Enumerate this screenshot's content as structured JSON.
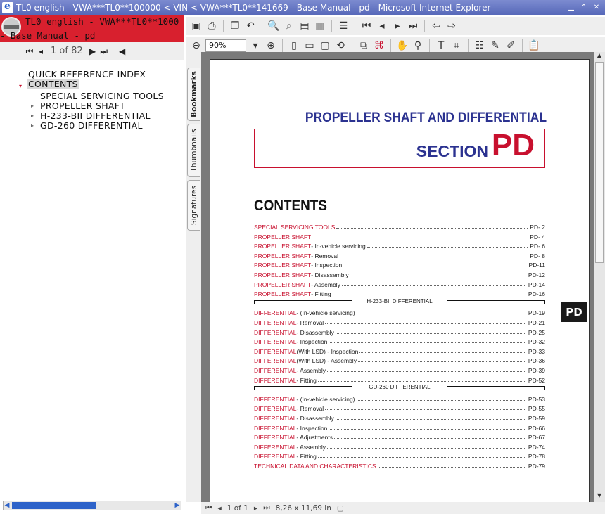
{
  "window": {
    "title": "TL0 english - VWA***TL0**100000 < VIN < VWA***TL0**141669 - Base Manual - pd - Microsoft Internet Explorer"
  },
  "left_panel": {
    "header_line1": "TL0 english - VWA***TL0**1000",
    "header_line2": "- Base Manual - pd",
    "page_indicator": "1 of 82",
    "tree": [
      {
        "label": "QUICK REFERENCE INDEX",
        "toggle": ""
      },
      {
        "label": "CONTENTS",
        "toggle": "▾"
      },
      {
        "label": "SPECIAL SERVICING TOOLS",
        "toggle": ""
      },
      {
        "label": "PROPELLER SHAFT",
        "toggle": "▸"
      },
      {
        "label": "H-233-BII DIFFERENTIAL",
        "toggle": "▸"
      },
      {
        "label": "GD-260 DIFFERENTIAL",
        "toggle": "▸"
      }
    ]
  },
  "toolbar": {
    "zoom": "90%"
  },
  "side_tabs": [
    "Bookmarks",
    "Thumbnails",
    "Signatures"
  ],
  "document": {
    "heading": "PROPELLER SHAFT AND DIFFERENTIAL",
    "section_word": "SECTION",
    "section_code": "PD",
    "contents_title": "CONTENTS",
    "section_tab": "PD",
    "toc": [
      {
        "red": "SPECIAL SERVICING TOOLS",
        "black": "",
        "page": "PD-  2"
      },
      {
        "red": "PROPELLER SHAFT",
        "black": "",
        "page": "PD-  4"
      },
      {
        "red": "PROPELLER SHAFT",
        "black": " - In-vehicle servicing",
        "page": "PD-  6"
      },
      {
        "red": "PROPELLER SHAFT",
        "black": " - Removal",
        "page": "PD-  8"
      },
      {
        "red": "PROPELLER SHAFT",
        "black": " - Inspection",
        "page": "PD-11"
      },
      {
        "red": "PROPELLER SHAFT",
        "black": " - Disassembly",
        "page": "PD-12"
      },
      {
        "red": "PROPELLER SHAFT",
        "black": " - Assembly",
        "page": "PD-14"
      },
      {
        "red": "PROPELLER SHAFT",
        "black": " - Fitting",
        "page": "PD-16"
      },
      {
        "sub": "H-233-BII DIFFERENTIAL"
      },
      {
        "red": "DIFFERENTIAL",
        "black": " - (In-vehicle servicing)",
        "page": "PD-19"
      },
      {
        "red": "DIFFERENTIAL",
        "black": " - Removal",
        "page": "PD-21"
      },
      {
        "red": "DIFFERENTIAL",
        "black": " - Disassembly",
        "page": "PD-25"
      },
      {
        "red": "DIFFERENTIAL",
        "black": " - Inspection",
        "page": "PD-32"
      },
      {
        "red": "DIFFERENTIAL",
        "black": " (With LSD) - Inspection",
        "page": "PD-33"
      },
      {
        "red": "DIFFERENTIAL",
        "black": " (With LSD) - Assembly",
        "page": "PD-36"
      },
      {
        "red": "DIFFERENTIAL",
        "black": " - Assembly",
        "page": "PD-39"
      },
      {
        "red": "DIFFERENTIAL",
        "black": " - Fitting",
        "page": "PD-52"
      },
      {
        "sub": "GD-260 DIFFERENTIAL"
      },
      {
        "red": "DIFFERENTIAL",
        "black": " - (In-vehicle servicing)",
        "page": "PD-53"
      },
      {
        "red": "DIFFERENTIAL",
        "black": " - Removal",
        "page": "PD-55"
      },
      {
        "red": "DIFFERENTIAL",
        "black": " - Disassembly",
        "page": "PD-59"
      },
      {
        "red": "DIFFERENTIAL",
        "black": " - Inspection",
        "page": "PD-66"
      },
      {
        "red": "DIFFERENTIAL",
        "black": " - Adjustments",
        "page": "PD-67"
      },
      {
        "red": "DIFFERENTIAL",
        "black": " - Assembly",
        "page": "PD-74"
      },
      {
        "red": "DIFFERENTIAL",
        "black": " - Fitting",
        "page": "PD-78"
      },
      {
        "red": "TECHNICAL DATA AND CHARACTERISTICS",
        "black": "",
        "page": "PD-79"
      }
    ]
  },
  "status": {
    "page": "1 of 1",
    "size": "8,26 x 11,69 in"
  },
  "colors": {
    "accent_red": "#d8202e",
    "doc_blue": "#2b3290",
    "doc_red": "#c8102e"
  }
}
